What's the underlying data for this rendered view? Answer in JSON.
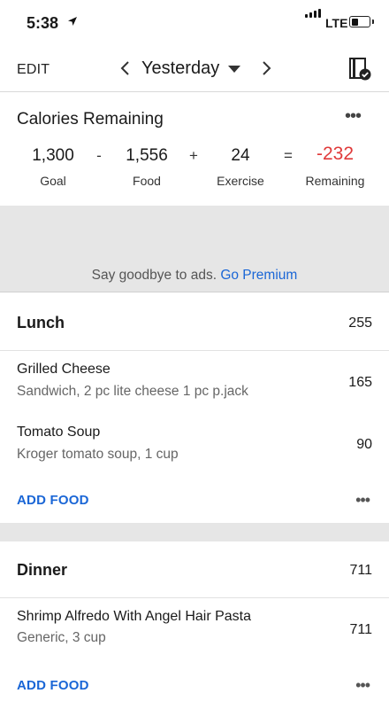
{
  "status_bar": {
    "time": "5:38",
    "network": "LTE"
  },
  "header": {
    "edit_label": "EDIT",
    "date": "Yesterday"
  },
  "calories": {
    "title": "Calories Remaining",
    "goal": "1,300",
    "goal_label": "Goal",
    "minus": "-",
    "food": "1,556",
    "food_label": "Food",
    "plus": "+",
    "exercise": "24",
    "exercise_label": "Exercise",
    "equals": "=",
    "remaining": "-232",
    "remaining_label": "Remaining",
    "more": "•••"
  },
  "ad": {
    "text": "Say goodbye to ads. ",
    "link": "Go Premium"
  },
  "meals": [
    {
      "name": "Lunch",
      "total": "255",
      "items": [
        {
          "name": "Grilled Cheese",
          "desc": "Sandwich, 2 pc lite cheese 1 pc p.jack",
          "cal": "165"
        },
        {
          "name": "Tomato Soup",
          "desc": "Kroger tomato soup, 1 cup",
          "cal": "90"
        }
      ],
      "add_label": "ADD FOOD",
      "more": "•••"
    },
    {
      "name": "Dinner",
      "total": "711",
      "items": [
        {
          "name": "Shrimp Alfredo With Angel Hair Pasta",
          "desc": "Generic, 3 cup",
          "cal": "711"
        }
      ],
      "add_label": "ADD FOOD",
      "more": "•••"
    }
  ],
  "icons": {
    "location": "location-arrow-icon",
    "battery": "battery-icon",
    "prev": "chevron-left-icon",
    "dropdown": "caret-down-icon",
    "next": "chevron-right-icon",
    "diary": "diary-complete-icon"
  },
  "colors": {
    "accent": "#1a66d6",
    "negative": "#e03a3a",
    "ad_bg": "#e6e6e6"
  }
}
